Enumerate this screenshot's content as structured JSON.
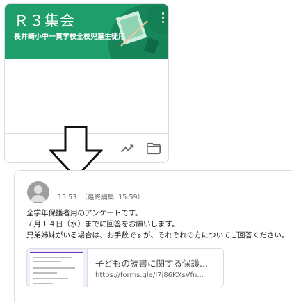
{
  "class_card": {
    "title": "Ｒ３集会",
    "subtitle": "長井崎小中一貫学校全校児童生徒用",
    "banner_color": "#1e9e6a",
    "actions": [
      {
        "icon": "trending-up-icon",
        "label": ""
      },
      {
        "icon": "folder-icon",
        "label": ""
      }
    ]
  },
  "annotation": {
    "icon": "down-arrow-icon"
  },
  "post": {
    "avatar": "avatar-icon",
    "timestamp": "15:53",
    "edited": "（最終編集: 15:59）",
    "body_lines": [
      "全学年保護者用のアンケートです。",
      "７月１４日（水）までに回答をお願いします。",
      "兄弟姉妹がいる場合は、お手数ですが、それぞれの方についてご回答ください。"
    ],
    "attachment": {
      "title": "子どもの読書に関する保護...",
      "url": "https://forms.gle/J7j86KXsVfn..."
    }
  }
}
